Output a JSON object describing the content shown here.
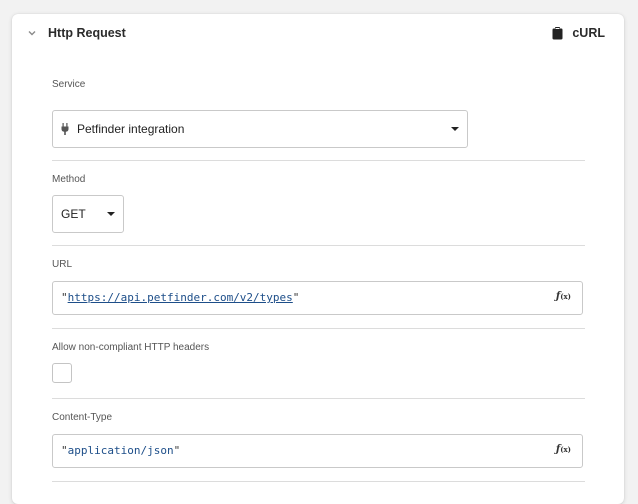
{
  "header": {
    "title": "Http Request",
    "curl_label": "cURL"
  },
  "service": {
    "label": "Service",
    "value": "Petfinder integration"
  },
  "method": {
    "label": "Method",
    "value": "GET"
  },
  "url": {
    "label": "URL",
    "value": "https://api.petfinder.com/v2/types"
  },
  "headers_option": {
    "label": "Allow non-compliant HTTP headers",
    "checked": false
  },
  "content_type": {
    "label": "Content-Type",
    "value": "application/json"
  },
  "formula_button": {
    "glyph": "ƒ",
    "sub": "(x)"
  },
  "colors": {
    "code_text": "#1d4e89",
    "border": "#c9c9c9",
    "divider": "#dcdcdc"
  },
  "icons": [
    "chevron-down-icon",
    "clipboard-icon",
    "plug-icon",
    "caret-down-icon",
    "function-icon"
  ]
}
